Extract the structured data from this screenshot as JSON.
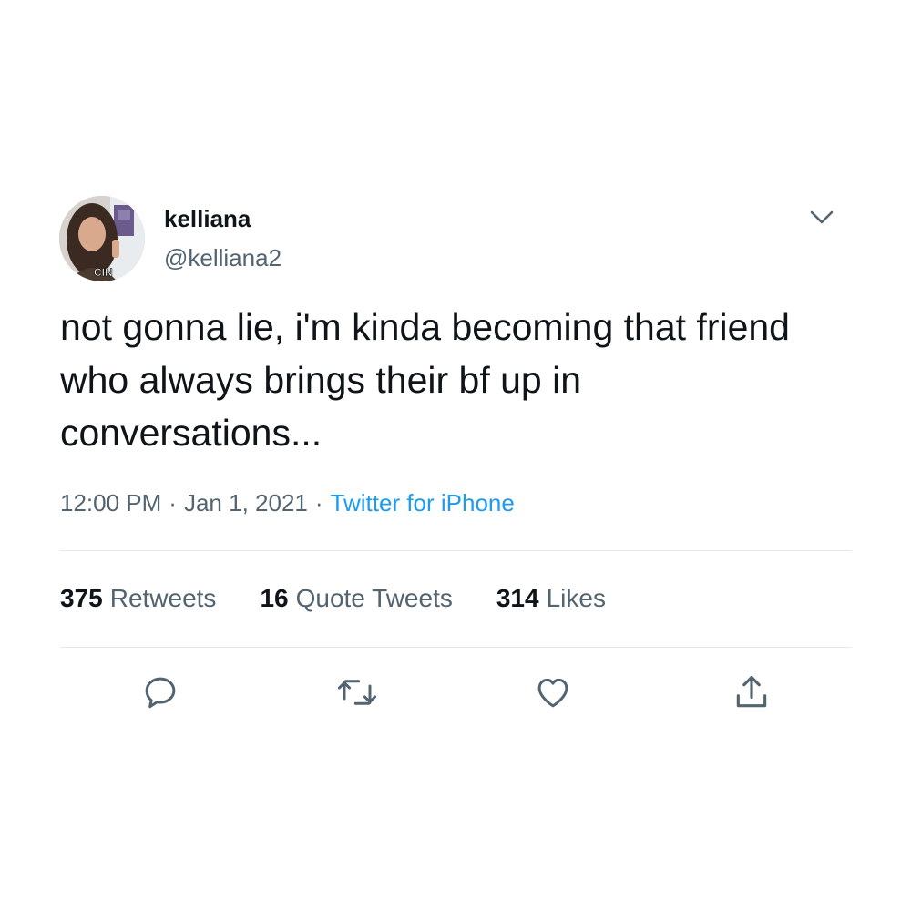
{
  "user": {
    "display_name": "kelliana",
    "handle": "@kelliana2",
    "avatar_badge": "CIN"
  },
  "tweet": {
    "text": "not gonna lie, i'm kinda becoming that friend who always brings their bf up in conversations...",
    "time": "12:00 PM",
    "date": "Jan 1, 2021",
    "source": "Twitter for iPhone"
  },
  "stats": {
    "retweets_count": "375",
    "retweets_label": "Retweets",
    "quotes_count": "16",
    "quotes_label": "Quote Tweets",
    "likes_count": "314",
    "likes_label": "Likes"
  },
  "icons": {
    "caret": "chevron-down-icon",
    "reply": "reply-icon",
    "retweet": "retweet-icon",
    "like": "heart-icon",
    "share": "share-icon"
  },
  "colors": {
    "text": "#0f1419",
    "secondary": "#536471",
    "link": "#1d9bf0",
    "divider": "#e6e9ec"
  }
}
